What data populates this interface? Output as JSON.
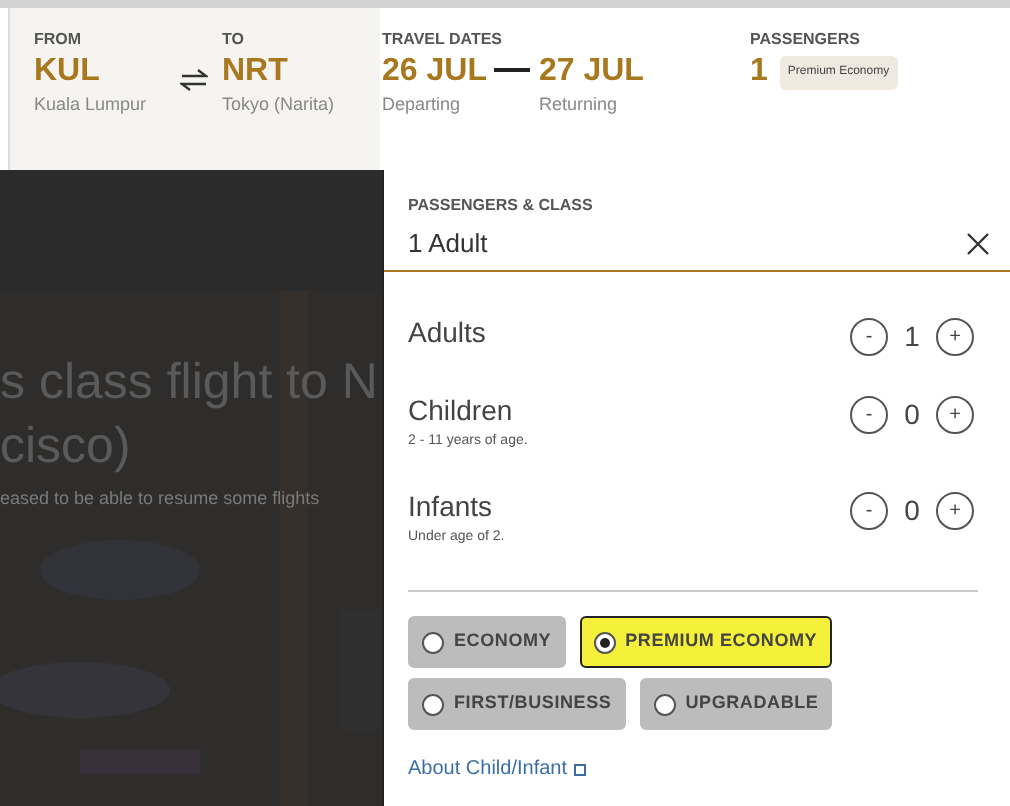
{
  "search_bar": {
    "from": {
      "label": "FROM",
      "code": "KUL",
      "city": "Kuala Lumpur"
    },
    "to": {
      "label": "TO",
      "code": "NRT",
      "city": "Tokyo (Narita)"
    },
    "dates": {
      "label": "TRAVEL DATES",
      "depart": "26 JUL",
      "depart_caption": "Departing",
      "return": "27 JUL",
      "return_caption": "Returning"
    },
    "passengers": {
      "label": "PASSENGERS",
      "count": "1",
      "class_badge": "Premium Economy"
    }
  },
  "background_page": {
    "headline_lines": [
      "s class flight to N",
      "cisco)"
    ],
    "subtext": "eased to be able to resume some flights"
  },
  "panel": {
    "title": "PASSENGERS & CLASS",
    "value": "1 Adult",
    "counters": [
      {
        "name": "Adults",
        "count": "1",
        "minus": "-",
        "plus": "+"
      },
      {
        "name": "Children",
        "note": "2 - 11 years of age.",
        "count": "0",
        "minus": "-",
        "plus": "+"
      },
      {
        "name": "Infants",
        "note": "Under age of 2.",
        "count": "0",
        "minus": "-",
        "plus": "+"
      }
    ],
    "classes": [
      {
        "label": "ECONOMY",
        "selected": false,
        "highlighted": false
      },
      {
        "label": "PREMIUM ECONOMY",
        "selected": true,
        "highlighted": true
      },
      {
        "label": "FIRST/BUSINESS",
        "selected": false,
        "highlighted": false
      },
      {
        "label": "UPGRADABLE",
        "selected": false,
        "highlighted": false
      }
    ],
    "link": "About Child/Infant"
  }
}
